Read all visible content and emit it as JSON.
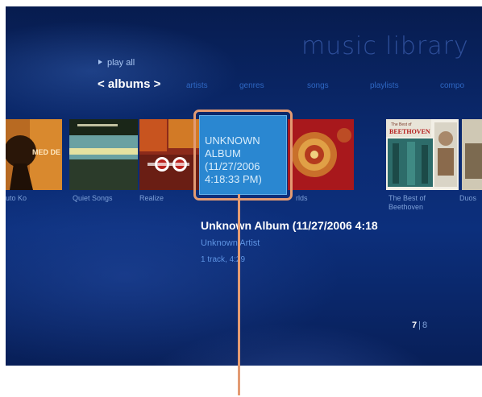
{
  "header": {
    "title": "music library",
    "play_all": "play all"
  },
  "nav": {
    "active": "< albums >",
    "items": [
      "artists",
      "genres",
      "songs",
      "playlists",
      "compo"
    ]
  },
  "albums": [
    {
      "label": "uto Ko",
      "art_text": "MED DE"
    },
    {
      "label": "Quiet Songs"
    },
    {
      "label": "Realize"
    },
    {
      "label": "rlds"
    },
    {
      "label": "The Best of\nBeethoven",
      "art_text_top": "The Best of",
      "art_text_main": "BEETHOVEN"
    },
    {
      "label": "Duos"
    }
  ],
  "selected": {
    "tile_text": "UNKNOWN\nALBUM\n(11/27/2006\n4:18:33 PM)",
    "title": "Unknown Album (11/27/2006 4:18",
    "artist": "Unknown Artist",
    "tracks": "1 track, 4:29"
  },
  "pager": {
    "current": "7",
    "separator": "|",
    "total": "8"
  },
  "colors": {
    "accent_frame": "#e39b73",
    "tile": "#2a87d1",
    "background": "#0b2b72"
  }
}
